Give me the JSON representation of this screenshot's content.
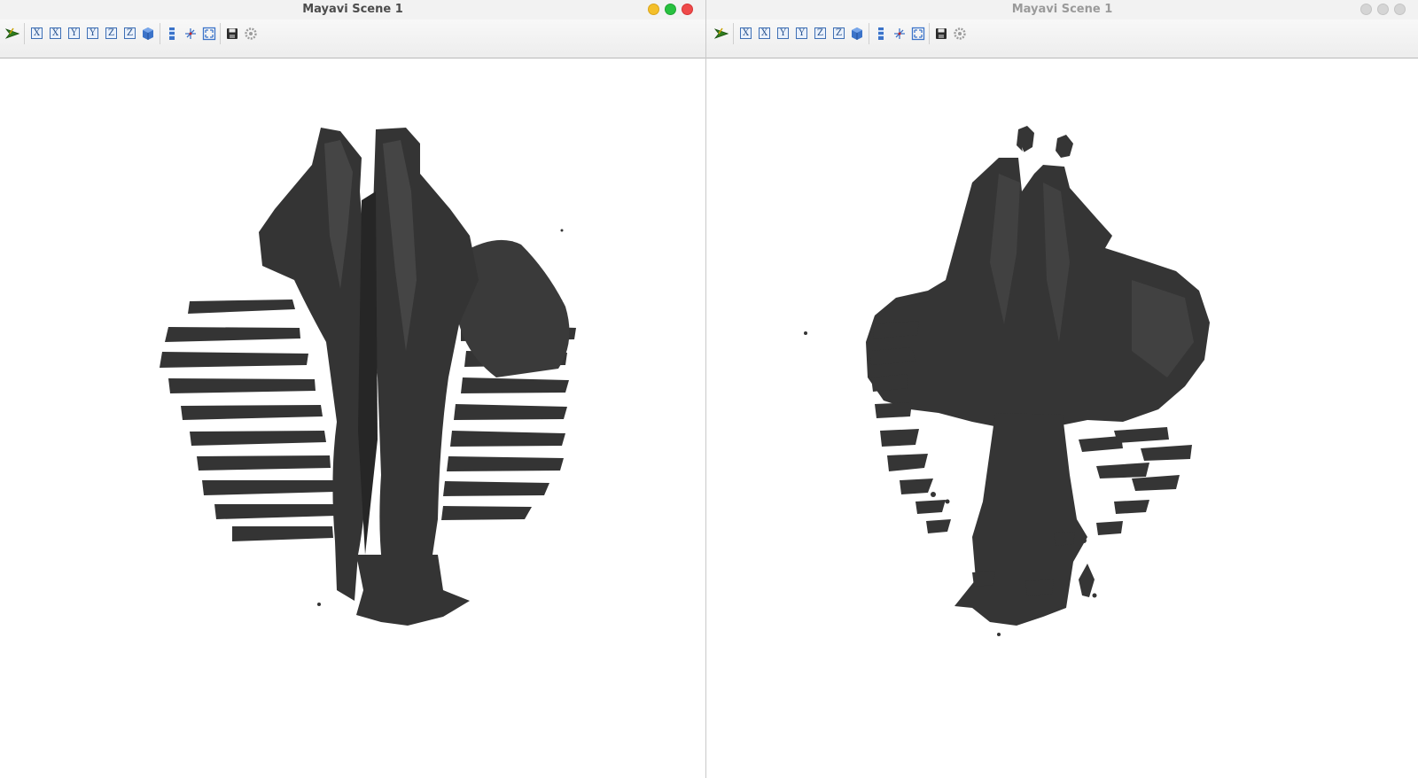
{
  "windows": [
    {
      "title": "Mayavi Scene 1",
      "state": "active",
      "toolbar": {
        "axis_buttons": [
          "X",
          "X",
          "Y",
          "Y",
          "Z",
          "Z"
        ],
        "icons": [
          "pipeline-icon",
          "isometric-icon",
          "parallel-projection-icon",
          "axes-icon",
          "fullscreen-icon",
          "save-icon",
          "configure-icon"
        ]
      }
    },
    {
      "title": "Mayavi Scene 1",
      "state": "inactive",
      "toolbar": {
        "axis_buttons": [
          "X",
          "X",
          "Y",
          "Y",
          "Z",
          "Z"
        ],
        "icons": [
          "pipeline-icon",
          "isometric-icon",
          "parallel-projection-icon",
          "axes-icon",
          "fullscreen-icon",
          "save-icon",
          "configure-icon"
        ]
      }
    }
  ],
  "colors": {
    "surface": "#363636",
    "surface_highlight": "#4a4a4a",
    "background": "#ffffff",
    "title_text": "#4c4c4c"
  }
}
